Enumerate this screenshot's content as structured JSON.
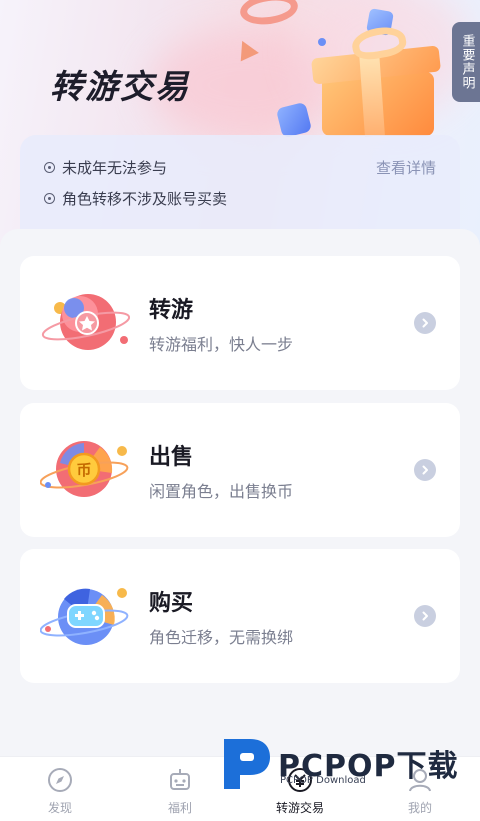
{
  "hero": {
    "title": "转游交易",
    "notice_tab": "重要声明"
  },
  "notice": {
    "items": [
      "未成年无法参与",
      "角色转移不涉及账号买卖"
    ],
    "detail_link": "查看详情"
  },
  "options": [
    {
      "title": "转游",
      "subtitle": "转游福利，快人一步",
      "icon": "star-planet-icon"
    },
    {
      "title": "出售",
      "subtitle": "闲置角色，出售换币",
      "icon": "coin-planet-icon"
    },
    {
      "title": "购买",
      "subtitle": "角色迁移，无需换绑",
      "icon": "gamepad-planet-icon"
    }
  ],
  "tabbar": {
    "items": [
      {
        "label": "发现",
        "icon": "compass-icon",
        "active": false
      },
      {
        "label": "福利",
        "icon": "robot-icon",
        "active": false
      },
      {
        "label": "转游交易",
        "icon": "trade-icon",
        "active": true
      },
      {
        "label": "我的",
        "icon": "profile-icon",
        "active": false
      }
    ]
  },
  "watermark": {
    "brand": "PCPOP下载",
    "sub": "PCPOP Download"
  },
  "colors": {
    "accent_blue": "#5479f2",
    "gift_orange": "#ff8a3d",
    "notice_bg": "#e8ecfc",
    "link_gray": "#8a93b5"
  }
}
